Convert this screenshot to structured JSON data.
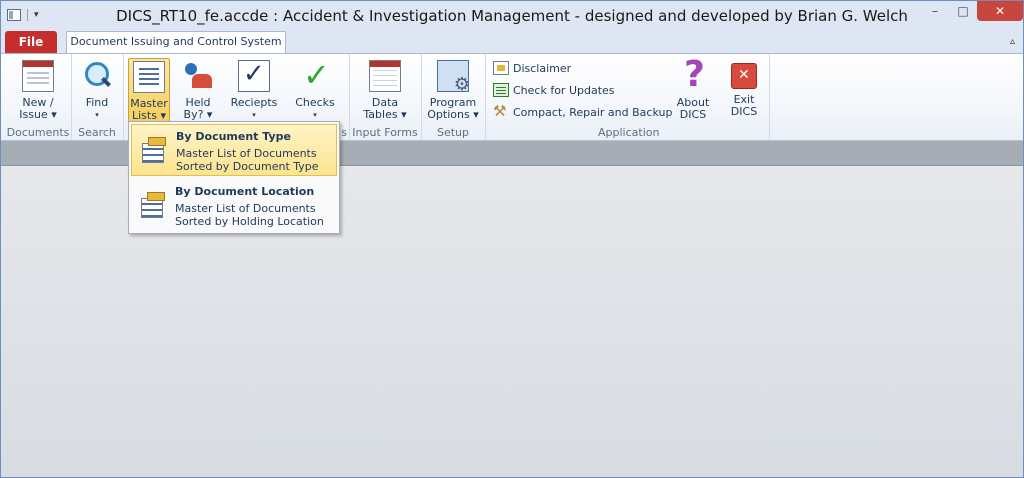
{
  "window": {
    "title": "DICS_RT10_fe.accde : Accident & Investigation Management - designed and developed by Brian G. Welch",
    "minimize": "–",
    "maximize": "□",
    "close": "✕"
  },
  "qat": {
    "dropdown": "▾"
  },
  "tabs": {
    "file": "File",
    "app": "Document Issuing and Control System",
    "collapse": "▵"
  },
  "ribbon": {
    "groups": {
      "documents": "Documents",
      "search": "Search",
      "input_forms": "Input Forms",
      "setup": "Setup",
      "application": "Application"
    },
    "buttons": {
      "new_issue": [
        "New /",
        "Issue ▾"
      ],
      "find": [
        "Find",
        "▾"
      ],
      "master_lists": [
        "Master",
        "Lists ▾"
      ],
      "held_by": [
        "Held",
        "By? ▾"
      ],
      "reciepts": [
        "Reciepts",
        "▾"
      ],
      "checks": [
        "Checks",
        "▾"
      ],
      "data_tables": [
        "Data",
        "Tables ▾"
      ],
      "program_options": [
        "Program",
        "Options ▾"
      ],
      "about": [
        "About",
        "DICS"
      ],
      "exit": [
        "Exit",
        "DICS"
      ]
    },
    "small": {
      "disclaimer": "Disclaimer",
      "check_updates": "Check for Updates",
      "compact": "Compact, Repair and Backup"
    },
    "partial_group_label": "s"
  },
  "menu": {
    "items": [
      {
        "title": "By Document Type",
        "line1": "Master List of Documents",
        "line2": "Sorted by Document Type",
        "highlighted": true
      },
      {
        "title": "By Document Location",
        "line1": "Master List of Documents",
        "line2": "Sorted by Holding Location",
        "highlighted": false
      }
    ]
  },
  "icons": {
    "new_issue": "form-icon",
    "find": "search-icon",
    "master_lists": "list-icon",
    "held_by": "people-icon",
    "reciepts": "checkbox-icon",
    "checks": "checkmark-icon",
    "data_tables": "table-icon",
    "program_options": "gear-icon",
    "about": "question-icon",
    "exit": "exit-icon",
    "disclaimer": "document-icon",
    "check_updates": "update-icon",
    "compact": "tools-icon"
  }
}
